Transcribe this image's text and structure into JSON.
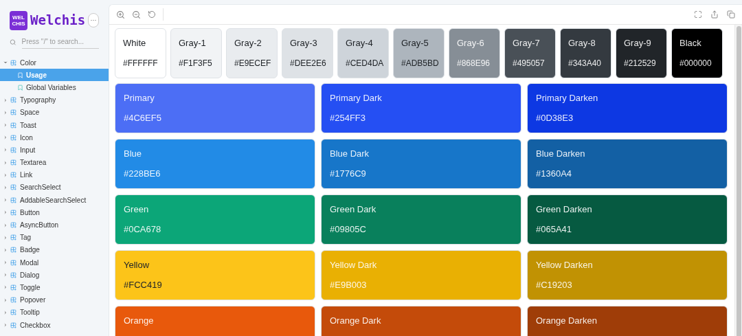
{
  "brand": {
    "logo_text": "WEL CHIS",
    "name": "Welchis",
    "menu": "···"
  },
  "search": {
    "placeholder": "Press \"/\" to search..."
  },
  "tree": [
    {
      "label": "Color",
      "expanded": true,
      "children": [
        {
          "label": "Usage",
          "selected": true
        },
        {
          "label": "Global Variables",
          "selected": false
        }
      ]
    },
    {
      "label": "Typography",
      "expanded": false
    },
    {
      "label": "Space",
      "expanded": false
    },
    {
      "label": "Toast",
      "expanded": false
    },
    {
      "label": "Icon",
      "expanded": false
    },
    {
      "label": "Input",
      "expanded": false
    },
    {
      "label": "Textarea",
      "expanded": false
    },
    {
      "label": "Link",
      "expanded": false
    },
    {
      "label": "SearchSelect",
      "expanded": false
    },
    {
      "label": "AddableSearchSelect",
      "expanded": false
    },
    {
      "label": "Button",
      "expanded": false
    },
    {
      "label": "AsyncButton",
      "expanded": false
    },
    {
      "label": "Tag",
      "expanded": false
    },
    {
      "label": "Badge",
      "expanded": false
    },
    {
      "label": "Modal",
      "expanded": false
    },
    {
      "label": "Dialog",
      "expanded": false
    },
    {
      "label": "Toggle",
      "expanded": false
    },
    {
      "label": "Popover",
      "expanded": false
    },
    {
      "label": "Tooltip",
      "expanded": false
    },
    {
      "label": "Checkbox",
      "expanded": false
    }
  ],
  "grays": [
    {
      "name": "White",
      "hex": "#FFFFFF",
      "color": "#ffffff"
    },
    {
      "name": "Gray-1",
      "hex": "#F1F3F5",
      "color": "#f1f3f5"
    },
    {
      "name": "Gray-2",
      "hex": "#E9ECEF",
      "color": "#e9ecef"
    },
    {
      "name": "Gray-3",
      "hex": "#DEE2E6",
      "color": "#dee2e6"
    },
    {
      "name": "Gray-4",
      "hex": "#CED4DA",
      "color": "#ced4da"
    },
    {
      "name": "Gray-5",
      "hex": "#ADB5BD",
      "color": "#adb5bd"
    },
    {
      "name": "Gray-6",
      "hex": "#868E96",
      "color": "#868e96"
    },
    {
      "name": "Gray-7",
      "hex": "#495057",
      "color": "#495057"
    },
    {
      "name": "Gray-8",
      "hex": "#343A40",
      "color": "#343a40"
    },
    {
      "name": "Gray-9",
      "hex": "#212529",
      "color": "#212529"
    },
    {
      "name": "Black",
      "hex": "#000000",
      "color": "#000000"
    }
  ],
  "palette": [
    {
      "name": "Primary",
      "hex": "#4C6EF5",
      "color": "#4c6ef5"
    },
    {
      "name": "Primary Dark",
      "hex": "#254FF3",
      "color": "#254ff3"
    },
    {
      "name": "Primary Darken",
      "hex": "#0D38E3",
      "color": "#0d38e3"
    },
    {
      "name": "Blue",
      "hex": "#228BE6",
      "color": "#228be6"
    },
    {
      "name": "Blue Dark",
      "hex": "#1776C9",
      "color": "#1776c9"
    },
    {
      "name": "Blue Darken",
      "hex": "#1360A4",
      "color": "#1360a4"
    },
    {
      "name": "Green",
      "hex": "#0CA678",
      "color": "#0ca678"
    },
    {
      "name": "Green Dark",
      "hex": "#09805C",
      "color": "#09805c"
    },
    {
      "name": "Green Darken",
      "hex": "#065A41",
      "color": "#065a41"
    },
    {
      "name": "Yellow",
      "hex": "#FCC419",
      "color": "#fcc419"
    },
    {
      "name": "Yellow Dark",
      "hex": "#E9B003",
      "color": "#e9b003"
    },
    {
      "name": "Yellow Darken",
      "hex": "#C19203",
      "color": "#c19203"
    },
    {
      "name": "Orange",
      "color": "#e8590c"
    },
    {
      "name": "Orange Dark",
      "color": "#c44b0a"
    },
    {
      "name": "Orange Darken",
      "color": "#9f3d08"
    }
  ]
}
